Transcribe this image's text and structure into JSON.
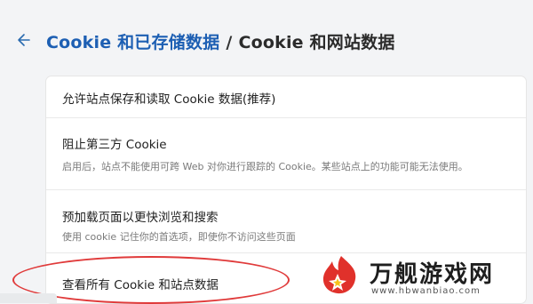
{
  "breadcrumb": {
    "parent": "Cookie 和已存储数据",
    "separator": "/",
    "current": "Cookie 和网站数据"
  },
  "settings": [
    {
      "title": "允许站点保存和读取 Cookie 数据(推荐)",
      "description": ""
    },
    {
      "title": "阻止第三方 Cookie",
      "description": "启用后，站点不能使用可跨 Web 对你进行跟踪的 Cookie。某些站点上的功能可能无法使用。"
    },
    {
      "title": "预加载页面以更快浏览和搜索",
      "description": "使用 cookie 记住你的首选项，即使你不访问这些页面"
    },
    {
      "title": "查看所有 Cookie 和站点数据",
      "description": ""
    }
  ],
  "watermark": {
    "brand": "万舰游戏网",
    "url": "www.hbwanbiao.com"
  },
  "icons": {
    "back": "arrow-left-icon",
    "logo": "flame-logo-icon"
  },
  "colors": {
    "accent": "#1d5fb3",
    "highlight": "#e03a3a"
  }
}
